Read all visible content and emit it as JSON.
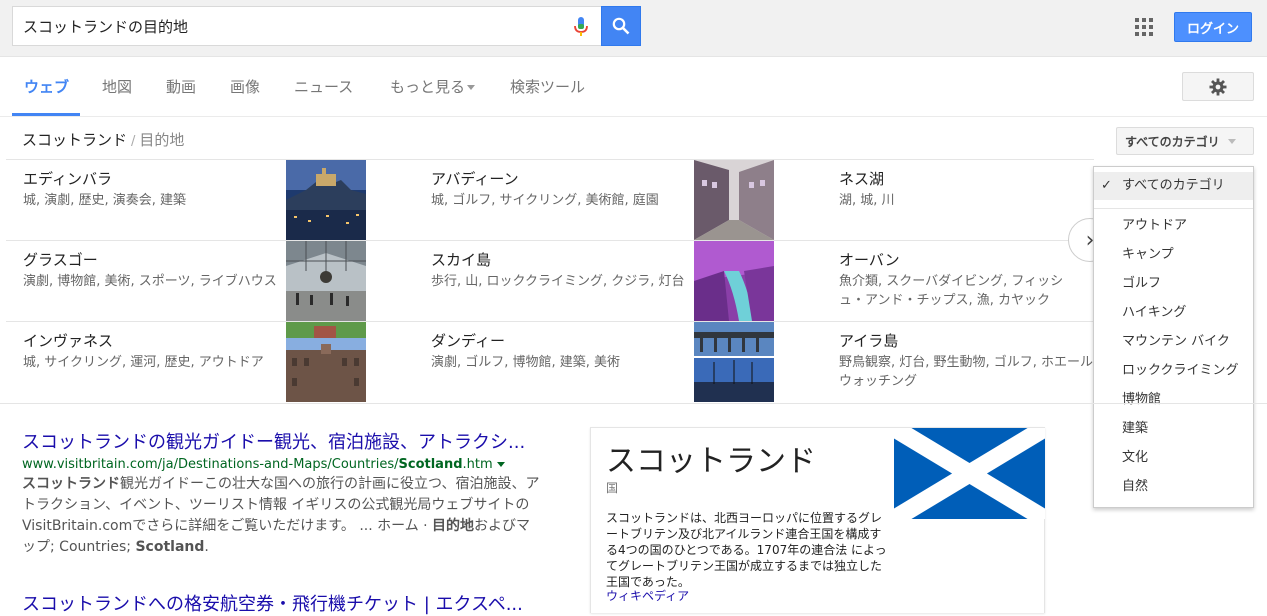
{
  "search": {
    "query": "スコットランドの目的地"
  },
  "header": {
    "login_label": "ログイン"
  },
  "tabs": [
    {
      "label": "ウェブ",
      "active": true
    },
    {
      "label": "地図"
    },
    {
      "label": "動画"
    },
    {
      "label": "画像"
    },
    {
      "label": "ニュース"
    },
    {
      "label": "もっと見る"
    },
    {
      "label": "検索ツール"
    }
  ],
  "breadcrumb": {
    "root": "スコットランド",
    "separator": "/",
    "current": "目的地"
  },
  "category_button": {
    "label": "すべてのカテゴリ"
  },
  "destinations": [
    {
      "name": "エディンバラ",
      "desc": "城, 演劇, 歴史, 演奏会, 建築"
    },
    {
      "name": "アバディーン",
      "desc": "城, ゴルフ, サイクリング, 美術館, 庭園"
    },
    {
      "name": "ネス湖",
      "desc": "湖, 城, 川"
    },
    {
      "name": "グラスゴー",
      "desc": "演劇, 博物館, 美術, スポーツ, ライブハウス"
    },
    {
      "name": "スカイ島",
      "desc": "歩行, 山, ロッククライミング, クジラ, 灯台"
    },
    {
      "name": "オーバン",
      "desc": "魚介類, スクーバダイビング, フィッシュ・アンド・チップス, 漁, カヤック"
    },
    {
      "name": "インヴァネス",
      "desc": "城, サイクリング, 運河, 歴史, アウトドア"
    },
    {
      "name": "ダンディー",
      "desc": "演劇, ゴルフ, 博物館, 建築, 美術"
    },
    {
      "name": "アイラ島",
      "desc": "野鳥観察, 灯台, 野生動物, ゴルフ, ホエールウォッチング"
    }
  ],
  "category_menu": {
    "selected": "すべてのカテゴリ",
    "items": [
      "アウトドア",
      "キャンプ",
      "ゴルフ",
      "ハイキング",
      "マウンテン バイク",
      "ロッククライミング",
      "博物館",
      "建築",
      "文化",
      "自然"
    ]
  },
  "results": [
    {
      "title": "スコットランドの観光ガイドー観光、宿泊施設、アトラクシ...",
      "url_prefix": "www.visitbritain.com/ja/Destinations-and-Maps/Countries/",
      "url_bold": "Scotland",
      "url_suffix": ".htm",
      "snippet_b1": "スコットランド",
      "snippet_1": "観光ガイドーこの壮大な国への旅行の計画に役立つ、宿泊施設、アトラクション、イベント、ツーリスト情報 イギリスの公式観光局ウェブサイトのVisitBritain.comでさらに詳細をご覧いただけます。 ... ホーム · ",
      "snippet_b2": "目的地",
      "snippet_2": "およびマップ; Countries; ",
      "snippet_b3": "Scotland",
      "snippet_3": "."
    },
    {
      "title": "スコットランドへの格安航空券・飛行機チケット | エクスペ..."
    }
  ],
  "knowledge_panel": {
    "title": "スコットランド",
    "subtitle": "国",
    "description": "スコットランドは、北西ヨーロッパに位置するグレートブリテン及び北アイルランド連合王国を構成する4つの国のひとつである。1707年の連合法 によってグレートブリテン王国が成立するまでは独立した王国であった。",
    "source": "ウィキペディア",
    "flag_colors": {
      "field": "#005eb8",
      "saltire": "#ffffff"
    }
  },
  "colors": {
    "accent": "#4285f4",
    "link": "#1a0dab",
    "url": "#006621"
  }
}
